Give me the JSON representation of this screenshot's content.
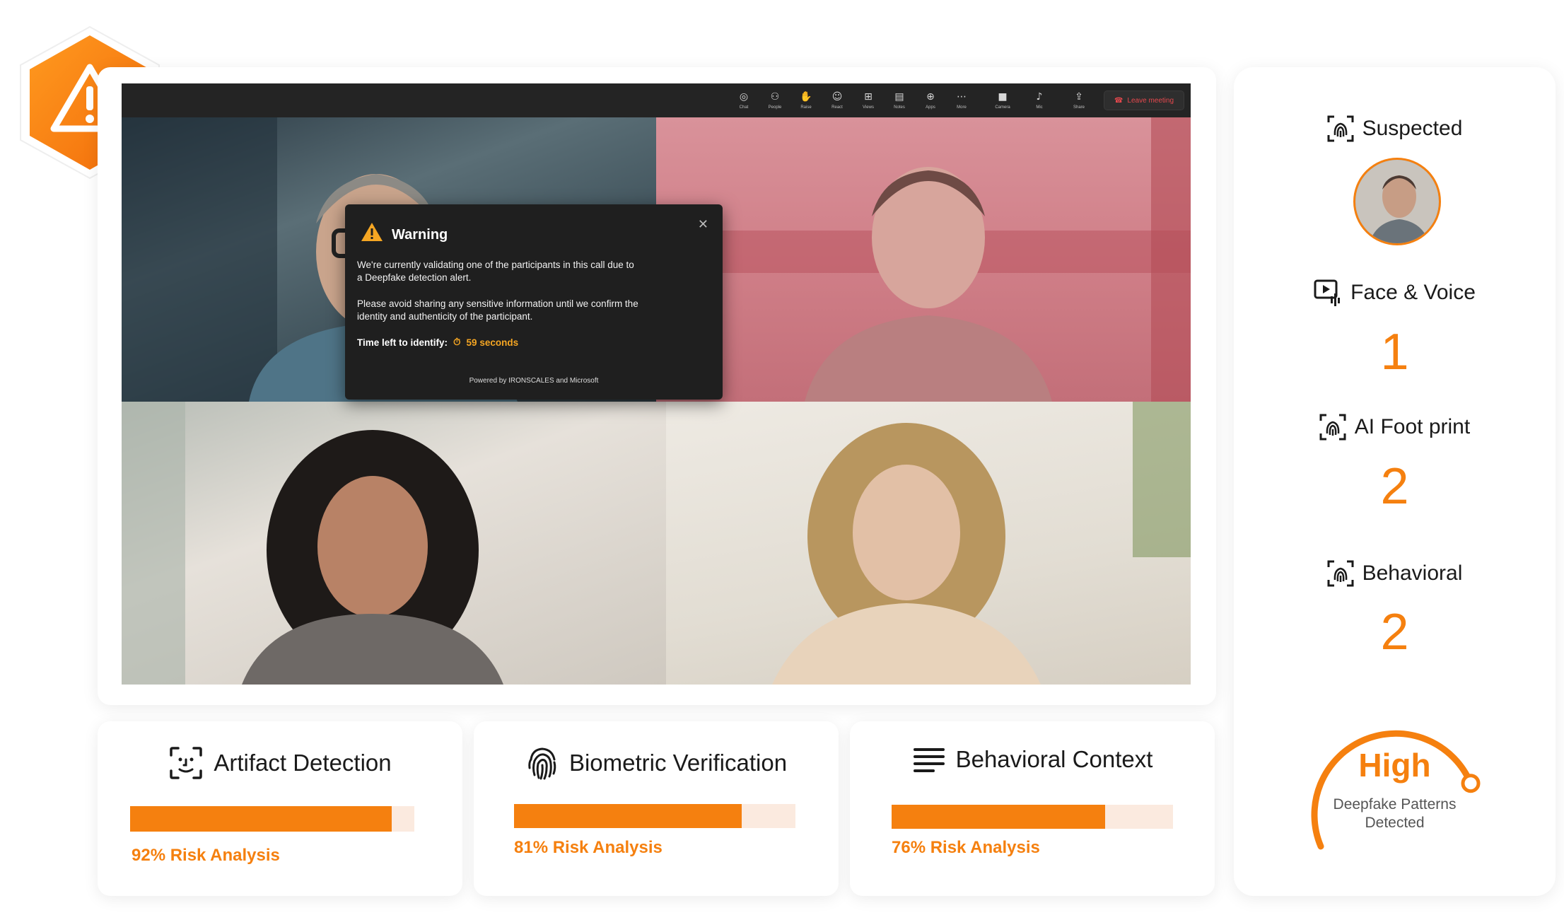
{
  "meeting": {
    "toolbar": [
      {
        "icon": "chat-icon",
        "label": "Chat",
        "glyph": "◎"
      },
      {
        "icon": "people-icon",
        "label": "People",
        "glyph": "⚇"
      },
      {
        "icon": "raise-hand-icon",
        "label": "Raise",
        "glyph": "✋"
      },
      {
        "icon": "react-icon",
        "label": "React",
        "glyph": "☺"
      },
      {
        "icon": "views-icon",
        "label": "Views",
        "glyph": "⊞"
      },
      {
        "icon": "notes-icon",
        "label": "Notes",
        "glyph": "▤"
      },
      {
        "icon": "apps-icon",
        "label": "Apps",
        "glyph": "⊕"
      },
      {
        "icon": "more-icon",
        "label": "More",
        "glyph": "⋯"
      },
      {
        "icon": "camera-icon",
        "label": "Camera",
        "glyph": "■"
      },
      {
        "icon": "mic-icon",
        "label": "Mic",
        "glyph": "♪"
      },
      {
        "icon": "share-icon",
        "label": "Share",
        "glyph": "⇪"
      }
    ],
    "leave_label": "Leave meeting",
    "leave_glyph": "☎"
  },
  "warning_dialog": {
    "title": "Warning",
    "close_glyph": "✕",
    "paragraph_1": "We're currently validating one of the participants in this call due to a Deepfake detection alert.",
    "paragraph_2": "Please avoid sharing any sensitive information until we confirm the identity and authenticity of the participant.",
    "timer_label": "Time left to identify:",
    "timer_glyph": "⏱",
    "timer_value": "59 seconds",
    "footer": "Powered by IRONSCALES and Microsoft"
  },
  "cards": [
    {
      "title": "Artifact Detection",
      "icon": "face-scan-icon",
      "risk_percent": 92,
      "risk_label": "92% Risk Analysis"
    },
    {
      "title": "Biometric Verification",
      "icon": "fingerprint-icon",
      "risk_percent": 81,
      "risk_label": "81% Risk Analysis"
    },
    {
      "title": "Behavioral Context",
      "icon": "text-lines-icon",
      "risk_percent": 76,
      "risk_label": "76% Risk Analysis"
    }
  ],
  "side_panel": {
    "suspected_label": "Suspected",
    "face_voice_label": "Face & Voice",
    "face_voice_value": "1",
    "ai_footprint_label": "AI Foot print",
    "ai_footprint_value": "2",
    "behavioral_label": "Behavioral",
    "behavioral_value": "2",
    "risk_level": "High",
    "risk_caption": "Deepfake Patterns\nDetected",
    "gauge_fraction": 0.8
  },
  "colors": {
    "accent": "#f5800f",
    "accent_light": "#fbeadf",
    "dialog_bg": "#1f1f1f",
    "badge_orange": "#f57c00"
  }
}
